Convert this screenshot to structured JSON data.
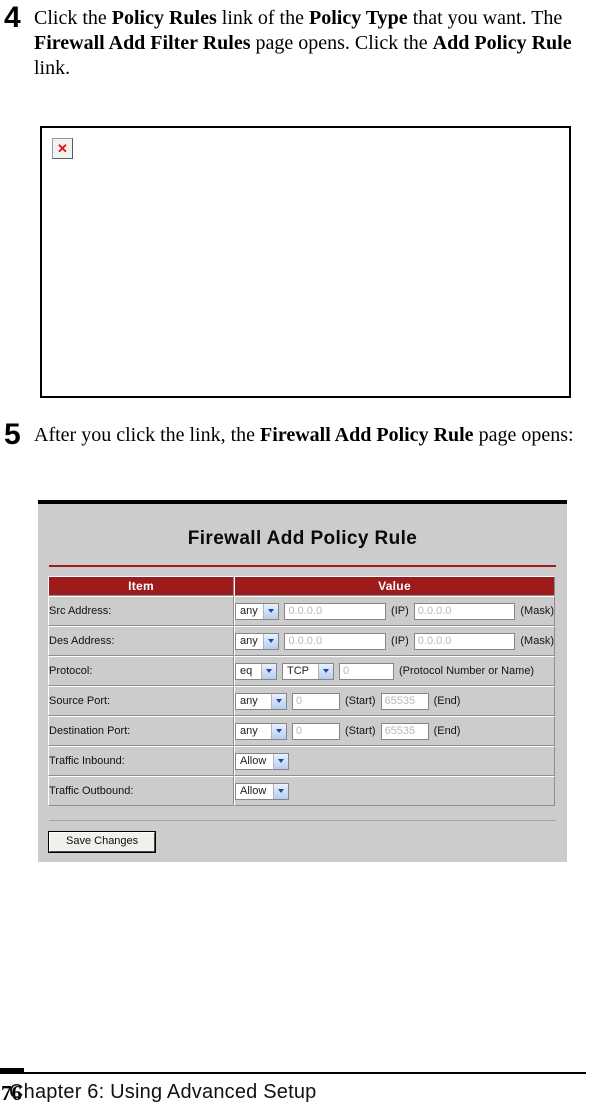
{
  "steps": [
    {
      "number": "4",
      "text_runs": [
        {
          "t": "Click the ",
          "b": false
        },
        {
          "t": "Policy Rules",
          "b": true
        },
        {
          "t": " link of the ",
          "b": false
        },
        {
          "t": "Policy Type",
          "b": true
        },
        {
          "t": " that you want. The ",
          "b": false
        },
        {
          "t": "Firewall Add Filter Rules",
          "b": true
        },
        {
          "t": " page opens. Click the ",
          "b": false
        },
        {
          "t": "Add Policy Rule",
          "b": true
        },
        {
          "t": " link.",
          "b": false
        }
      ]
    },
    {
      "number": "5",
      "text_runs": [
        {
          "t": "After you click the link, the ",
          "b": false
        },
        {
          "t": "Firewall Add Policy Rule",
          "b": true
        },
        {
          "t": " page opens:",
          "b": false
        }
      ]
    }
  ],
  "broken_figure": {
    "icon_name": "broken-image-icon",
    "glyph": "✕"
  },
  "firewall": {
    "title": "Firewall Add Policy Rule",
    "accent_color": "#9E1B1B",
    "background_color": "#CCCCCC",
    "headers": {
      "item": "Item",
      "value": "Value"
    },
    "rows": [
      {
        "label": "Src Address:",
        "kind": "address",
        "select": "any",
        "ip_value": "0.0.0.0",
        "ip_unit": "(IP)",
        "mask_value": "0.0.0.0",
        "mask_unit": "(Mask)"
      },
      {
        "label": "Des Address:",
        "kind": "address",
        "select": "any",
        "ip_value": "0.0.0.0",
        "ip_unit": "(IP)",
        "mask_value": "0.0.0.0",
        "mask_unit": "(Mask)"
      },
      {
        "label": "Protocol:",
        "kind": "protocol",
        "op_select": "eq",
        "proto_select": "TCP",
        "proto_value": "0",
        "proto_unit": "(Protocol Number or Name)"
      },
      {
        "label": "Source Port:",
        "kind": "port",
        "select": "any",
        "start_value": "0",
        "start_unit": "(Start)",
        "end_value": "65535",
        "end_unit": "(End)"
      },
      {
        "label": "Destination Port:",
        "kind": "port",
        "select": "any",
        "start_value": "0",
        "start_unit": "(Start)",
        "end_value": "65535",
        "end_unit": "(End)"
      },
      {
        "label": "Traffic Inbound:",
        "kind": "traffic",
        "select": "Allow"
      },
      {
        "label": "Traffic Outbound:",
        "kind": "traffic",
        "select": "Allow"
      }
    ],
    "save_button": "Save Changes"
  },
  "footer": {
    "page_number": "76",
    "chapter": "Chapter 6: Using Advanced Setup"
  }
}
